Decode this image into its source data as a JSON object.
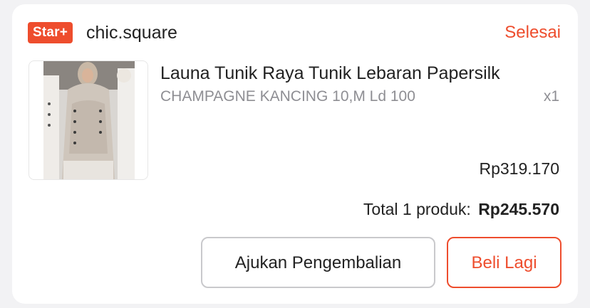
{
  "shop": {
    "badge_label": "Star+",
    "name": "chic.square"
  },
  "order": {
    "status": "Selesai"
  },
  "product": {
    "image_icon": "dress-photo",
    "title": "Launa Tunik Raya Tunik Lebaran Papersilk",
    "variant": "CHAMPAGNE KANCING 10,M Ld 100",
    "quantity": "x1",
    "price": "Rp319.170"
  },
  "summary": {
    "total_label": "Total 1 produk:",
    "total_amount": "Rp245.570"
  },
  "actions": {
    "return_label": "Ajukan Pengembalian",
    "buy_again_label": "Beli Lagi"
  },
  "colors": {
    "accent": "#ee4d2d",
    "text_primary": "#222222",
    "text_secondary": "#8e8e93"
  }
}
